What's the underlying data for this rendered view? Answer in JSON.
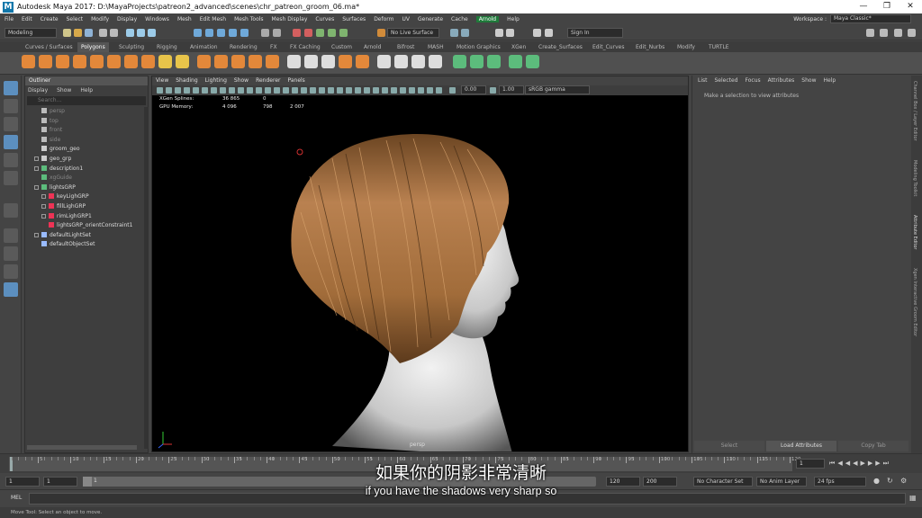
{
  "window": {
    "title": "Autodesk Maya 2017: D:\\MayaProjects\\patreon2_advanced\\scenes\\chr_patreon_groom_06.ma*",
    "logo": "M"
  },
  "menubar": {
    "items": [
      "File",
      "Edit",
      "Create",
      "Select",
      "Modify",
      "Display",
      "Windows",
      "Mesh",
      "Edit Mesh",
      "Mesh Tools",
      "Mesh Display",
      "Curves",
      "Surfaces",
      "Deform",
      "UV",
      "Generate",
      "Cache"
    ],
    "plugin": "Arnold",
    "last": "Help",
    "workspace_label": "Workspace :",
    "workspace_value": "Maya Classic*"
  },
  "statusline": {
    "mode": "Modeling",
    "live_surface": "No Live Surface",
    "sign_in": "Sign In"
  },
  "shelf_tabs": [
    "Curves / Surfaces",
    "Polygons",
    "Sculpting",
    "Rigging",
    "Animation",
    "Rendering",
    "FX",
    "FX Caching",
    "Custom",
    "Arnold",
    "Bifrost",
    "MASH",
    "Motion Graphics",
    "XGen",
    "Create_Surfaces",
    "Edit_Curves",
    "Edit_Nurbs",
    "Modify",
    "TURTLE"
  ],
  "outliner": {
    "title": "Outliner",
    "menu": [
      "Display",
      "Show",
      "Help"
    ],
    "search_placeholder": "Search...",
    "items": [
      {
        "label": "persp",
        "dim": true
      },
      {
        "label": "top",
        "dim": true
      },
      {
        "label": "front",
        "dim": true
      },
      {
        "label": "side",
        "dim": true
      },
      {
        "label": "groom_geo",
        "dim": false
      },
      {
        "label": "geo_grp",
        "dim": false
      },
      {
        "label": "description1",
        "dim": false
      },
      {
        "label": "xgGuide",
        "dim": true
      },
      {
        "label": "lightsGRP",
        "dim": false
      },
      {
        "label": "keyLighGRP",
        "dim": false
      },
      {
        "label": "fillLighGRP",
        "dim": false
      },
      {
        "label": "rimLighGRP1",
        "dim": false
      },
      {
        "label": "lightsGRP_orientConstraint1",
        "dim": false
      },
      {
        "label": "defaultLightSet",
        "dim": false
      },
      {
        "label": "defaultObjectSet",
        "dim": false
      }
    ]
  },
  "viewport": {
    "menu": [
      "View",
      "Shading",
      "Lighting",
      "Show",
      "Renderer",
      "Panels"
    ],
    "exposure": "0.00",
    "gamma": "1.00",
    "color_space": "sRGB gamma",
    "hud": [
      {
        "label": "XGen Splines:",
        "a": "36 865",
        "b": "0",
        "c": ""
      },
      {
        "label": "GPU Memory:",
        "a": "4 096",
        "b": "798",
        "c": "2 007"
      }
    ],
    "camera": "persp"
  },
  "attribute_editor": {
    "menu": [
      "List",
      "Selected",
      "Focus",
      "Attributes",
      "Show",
      "Help"
    ],
    "message": "Make a selection to view attributes",
    "buttons": [
      "Select",
      "Load Attributes",
      "Copy Tab"
    ]
  },
  "side_tabs": [
    "Channel Box / Layer Editor",
    "Modeling Toolkit",
    "Attribute Editor",
    "Xgen Interactive Groom Editor"
  ],
  "timeline": {
    "ticks": [
      "5",
      "10",
      "15",
      "20",
      "25",
      "30",
      "35",
      "40",
      "45",
      "50",
      "55",
      "60",
      "65",
      "70",
      "75",
      "80",
      "85",
      "90",
      "95",
      "100",
      "105",
      "110",
      "115",
      "120"
    ],
    "current_frame": "1"
  },
  "range": {
    "start": "1",
    "start2": "1",
    "slider_label": "1",
    "end_a": "120",
    "end_b": "200",
    "character_set": "No Character Set",
    "anim_layer": "No Anim Layer",
    "fps": "24 fps"
  },
  "cmdline": {
    "label": "MEL",
    "help": "Move Tool: Select an object to move."
  },
  "subtitles": {
    "cn": "如果你的阴影非常清晰",
    "en": "if you have the shadows very sharp so"
  },
  "colors": {
    "hair": "#a8743f",
    "skin": "#d9d9d9",
    "accent": "#5c8fbf"
  }
}
